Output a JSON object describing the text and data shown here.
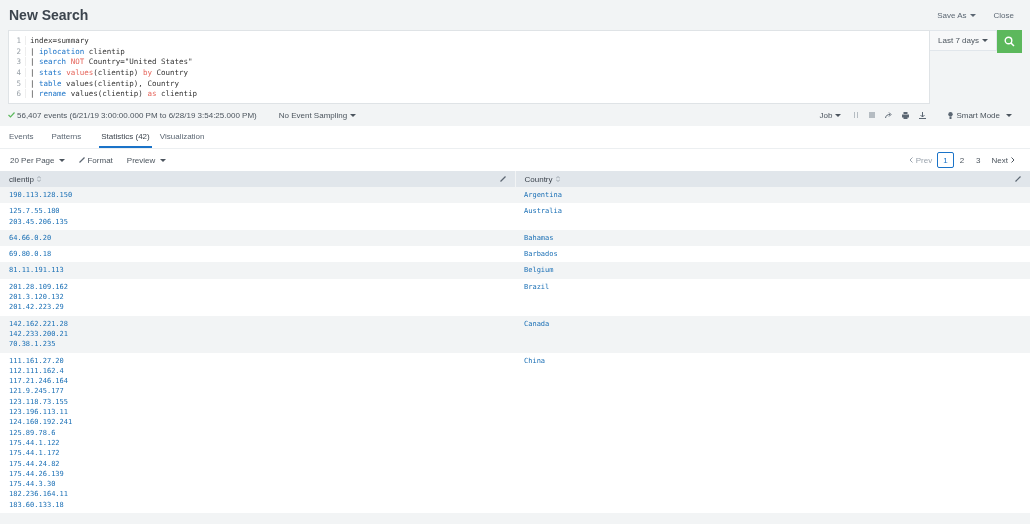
{
  "page": {
    "title": "New Search"
  },
  "header_actions": [
    {
      "label": "Save As",
      "dropdown": true
    },
    {
      "label": "Close",
      "dropdown": false
    }
  ],
  "search": {
    "lines": [
      {
        "number": "1",
        "segments": [
          {
            "text": "index=summary",
            "kind": "plain"
          }
        ]
      },
      {
        "number": "2",
        "segments": [
          {
            "text": "| ",
            "kind": "plain"
          },
          {
            "text": "iplocation",
            "kind": "command"
          },
          {
            "text": " clientip",
            "kind": "plain"
          }
        ]
      },
      {
        "number": "3",
        "segments": [
          {
            "text": "| ",
            "kind": "plain"
          },
          {
            "text": "search ",
            "kind": "command"
          },
          {
            "text": "NOT",
            "kind": "keyword"
          },
          {
            "text": " Country=\"United States\"",
            "kind": "plain"
          }
        ]
      },
      {
        "number": "4",
        "segments": [
          {
            "text": "| ",
            "kind": "plain"
          },
          {
            "text": "stats ",
            "kind": "command"
          },
          {
            "text": "values",
            "kind": "keyword"
          },
          {
            "text": "(clientip) ",
            "kind": "plain"
          },
          {
            "text": "by",
            "kind": "keyword"
          },
          {
            "text": " Country",
            "kind": "plain"
          }
        ]
      },
      {
        "number": "5",
        "segments": [
          {
            "text": "| ",
            "kind": "plain"
          },
          {
            "text": "table",
            "kind": "command"
          },
          {
            "text": " values(clientip), Country",
            "kind": "plain"
          }
        ]
      },
      {
        "number": "6",
        "segments": [
          {
            "text": "| ",
            "kind": "plain"
          },
          {
            "text": "rename",
            "kind": "command"
          },
          {
            "text": " values(clientip) ",
            "kind": "plain"
          },
          {
            "text": "as",
            "kind": "keyword"
          },
          {
            "text": " clientip",
            "kind": "plain"
          }
        ]
      }
    ],
    "time_picker": "Last 7 days"
  },
  "status": {
    "summary": "56,407 events (6/21/19 3:00:00.000 PM to 6/28/19 3:54:25.000 PM)",
    "sampling": "No Event Sampling",
    "job": "Job",
    "mode": "Smart Mode"
  },
  "tabs": [
    {
      "label": "Events",
      "selected": false
    },
    {
      "label": "Patterns",
      "selected": false
    },
    {
      "label": "Statistics (42)",
      "selected": true
    },
    {
      "label": "Visualization",
      "selected": false
    }
  ],
  "toolbar": {
    "per_page": "20 Per Page",
    "format": "Format",
    "preview": "Preview"
  },
  "pagination": {
    "prev": {
      "label": "Prev",
      "disabled": true
    },
    "pages": [
      {
        "label": "1",
        "selected": true
      },
      {
        "label": "2",
        "selected": false
      },
      {
        "label": "3",
        "selected": false
      }
    ],
    "next": {
      "label": "Next",
      "disabled": false
    }
  },
  "table": {
    "columns": [
      "clientip",
      "Country"
    ],
    "rows": [
      {
        "clientip": [
          "190.113.128.150"
        ],
        "country": "Argentina"
      },
      {
        "clientip": [
          "125.7.55.180",
          "203.45.206.135"
        ],
        "country": "Australia"
      },
      {
        "clientip": [
          "64.66.0.20"
        ],
        "country": "Bahamas"
      },
      {
        "clientip": [
          "69.80.0.18"
        ],
        "country": "Barbados"
      },
      {
        "clientip": [
          "81.11.191.113"
        ],
        "country": "Belgium"
      },
      {
        "clientip": [
          "201.28.109.162",
          "201.3.120.132",
          "201.42.223.29"
        ],
        "country": "Brazil"
      },
      {
        "clientip": [
          "142.162.221.28",
          "142.233.200.21",
          "70.38.1.235"
        ],
        "country": "Canada"
      },
      {
        "clientip": [
          "111.161.27.20",
          "112.111.162.4",
          "117.21.246.164",
          "121.9.245.177",
          "123.118.73.155",
          "123.196.113.11",
          "124.160.192.241",
          "125.89.78.6",
          "175.44.1.122",
          "175.44.1.172",
          "175.44.24.82",
          "175.44.26.139",
          "175.44.3.30",
          "182.236.164.11",
          "183.60.133.18"
        ],
        "country": "China"
      }
    ]
  }
}
